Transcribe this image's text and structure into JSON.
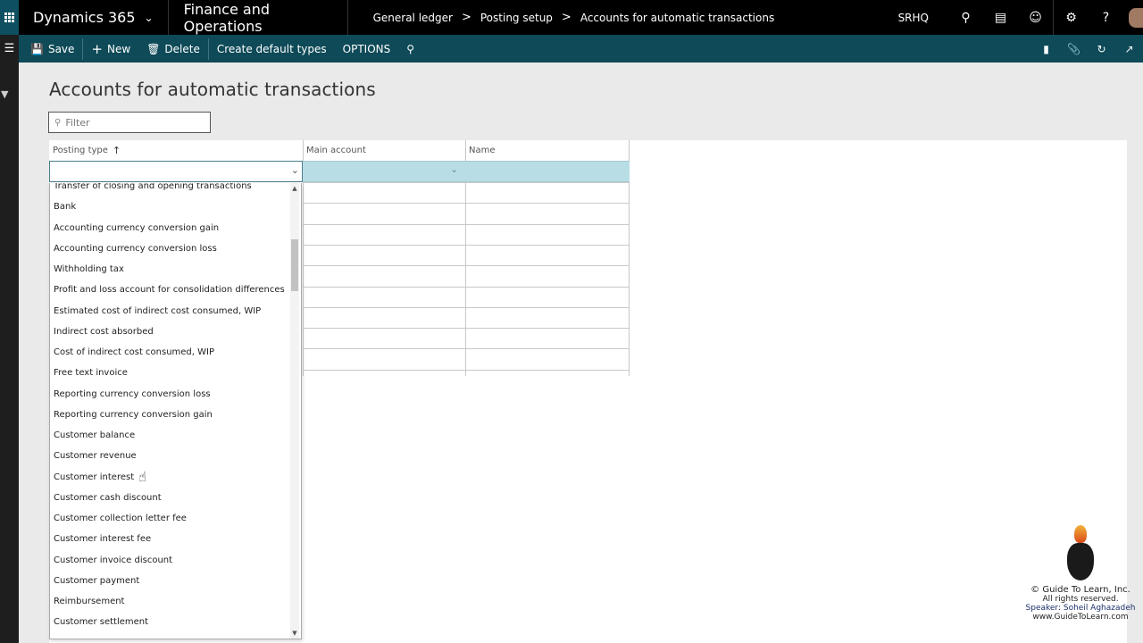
{
  "topbar": {
    "brand": "Dynamics 365",
    "module": "Finance and Operations",
    "breadcrumb": [
      "General ledger",
      "Posting setup",
      "Accounts for automatic transactions"
    ],
    "company": "SRHQ"
  },
  "actionbar": {
    "save": "Save",
    "new": "New",
    "delete": "Delete",
    "create_default_types": "Create default types",
    "options": "OPTIONS"
  },
  "page": {
    "title": "Accounts for automatic transactions",
    "filter_placeholder": "Filter"
  },
  "grid": {
    "columns": [
      "Posting type",
      "Main account",
      "Name"
    ],
    "sort_indicator": "↑",
    "selected_row": {
      "posting_type": "",
      "main_account": "",
      "name": ""
    },
    "empty_rows": 9
  },
  "dropdown": {
    "items": [
      "Transfer of closing and opening transactions",
      "Bank",
      "Accounting currency conversion gain",
      "Accounting currency conversion loss",
      "Withholding tax",
      "Profit and loss account for consolidation differences",
      "Estimated cost of indirect cost consumed, WIP",
      "Indirect cost absorbed",
      "Cost of indirect cost consumed, WIP",
      "Free text invoice",
      "Reporting currency conversion loss",
      "Reporting currency conversion gain",
      "Customer balance",
      "Customer revenue",
      "Customer interest",
      "Customer cash discount",
      "Customer collection letter fee",
      "Customer interest fee",
      "Customer invoice discount",
      "Customer payment",
      "Reimbursement",
      "Customer settlement"
    ],
    "scroll_position": 0.12
  },
  "watermark": {
    "line1": "© Guide To Learn, Inc.",
    "line2": "All rights reserved.",
    "line3": "Speaker: Soheil Aghazadeh",
    "line4": "www.GuideToLearn.com"
  },
  "colors": {
    "topbar": "#000000",
    "actionbar": "#0e4a58",
    "selected_row": "#b9dde5"
  }
}
